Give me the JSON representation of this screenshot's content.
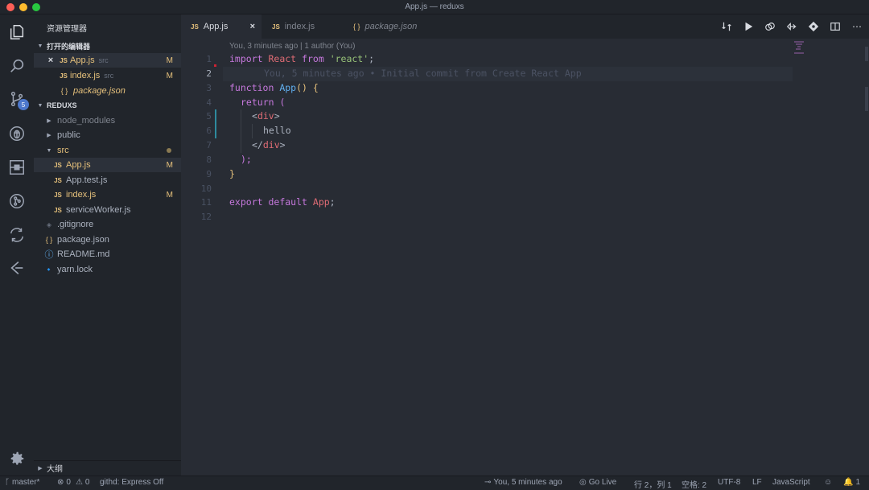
{
  "window": {
    "title": "App.js — reduxs"
  },
  "activity_bar": {
    "scm_badge": "5"
  },
  "sidebar": {
    "title": "资源管理器",
    "open_editors": {
      "header": "打开的编辑器",
      "items": [
        {
          "icon": "JS",
          "name": "App.js",
          "sub": "src",
          "flag": "M"
        },
        {
          "icon": "JS",
          "name": "index.js",
          "sub": "src",
          "flag": "M"
        },
        {
          "icon": "{ }",
          "name": "package.json"
        }
      ]
    },
    "project": {
      "header": "REDUXS",
      "items": [
        {
          "name": "node_modules"
        },
        {
          "name": "public"
        },
        {
          "name": "src"
        },
        {
          "icon": "JS",
          "name": "App.js",
          "flag": "M"
        },
        {
          "icon": "JS",
          "name": "App.test.js"
        },
        {
          "icon": "JS",
          "name": "index.js",
          "flag": "M"
        },
        {
          "icon": "JS",
          "name": "serviceWorker.js"
        },
        {
          "icon": "◈",
          "name": ".gitignore"
        },
        {
          "icon": "{ }",
          "name": "package.json"
        },
        {
          "icon": "ⓘ",
          "name": "README.md"
        },
        {
          "icon": "🔹",
          "name": "yarn.lock"
        }
      ]
    },
    "outline_label": "大纲"
  },
  "tabs": [
    {
      "icon": "JS",
      "label": "App.js",
      "active": true
    },
    {
      "icon": "JS",
      "label": "index.js"
    },
    {
      "icon": "{ }",
      "label": "package.json"
    }
  ],
  "editor": {
    "codelens": "You, 3 minutes ago | 1 author (You)",
    "blame": "You, 5 minutes ago • Initial commit from Create React App",
    "line_numbers": [
      "1",
      "2",
      "3",
      "4",
      "5",
      "6",
      "7",
      "8",
      "9",
      "10",
      "11",
      "12"
    ],
    "current_line": "2",
    "code": {
      "l1": {
        "kw1": "import",
        "var": "React",
        "kw2": "from",
        "str": "'react'",
        "end": ";"
      },
      "l3": {
        "kw": "function",
        "fn": "App",
        "paren": "()",
        "brace": "{"
      },
      "l4": {
        "kw": "return",
        "paren": "("
      },
      "l5": {
        "open": "<",
        "tag": "div",
        "close": ">"
      },
      "l6": {
        "text": "hello"
      },
      "l7": {
        "open": "</",
        "tag": "div",
        "close": ">"
      },
      "l8": {
        "text": ");"
      },
      "l9": {
        "brace": "}"
      },
      "l11": {
        "kw1": "export",
        "kw2": "default",
        "var": "App",
        "end": ";"
      }
    }
  },
  "statusbar": {
    "branch": "master*",
    "errors": "0",
    "warnings": "0",
    "githd": "githd: Express Off",
    "blame": "You, 5 minutes ago",
    "golive": "Go Live",
    "position": "行 2，列 1",
    "spaces": "空格: 2",
    "encoding": "UTF-8",
    "eol": "LF",
    "language": "JavaScript",
    "notifications": "1"
  },
  "colors": {
    "background": "#282c34",
    "sidebar": "#21252b",
    "keyword": "#c678dd",
    "variable": "#e06c75",
    "string": "#98c379",
    "function": "#61afef",
    "modified": "#e5c07b"
  }
}
